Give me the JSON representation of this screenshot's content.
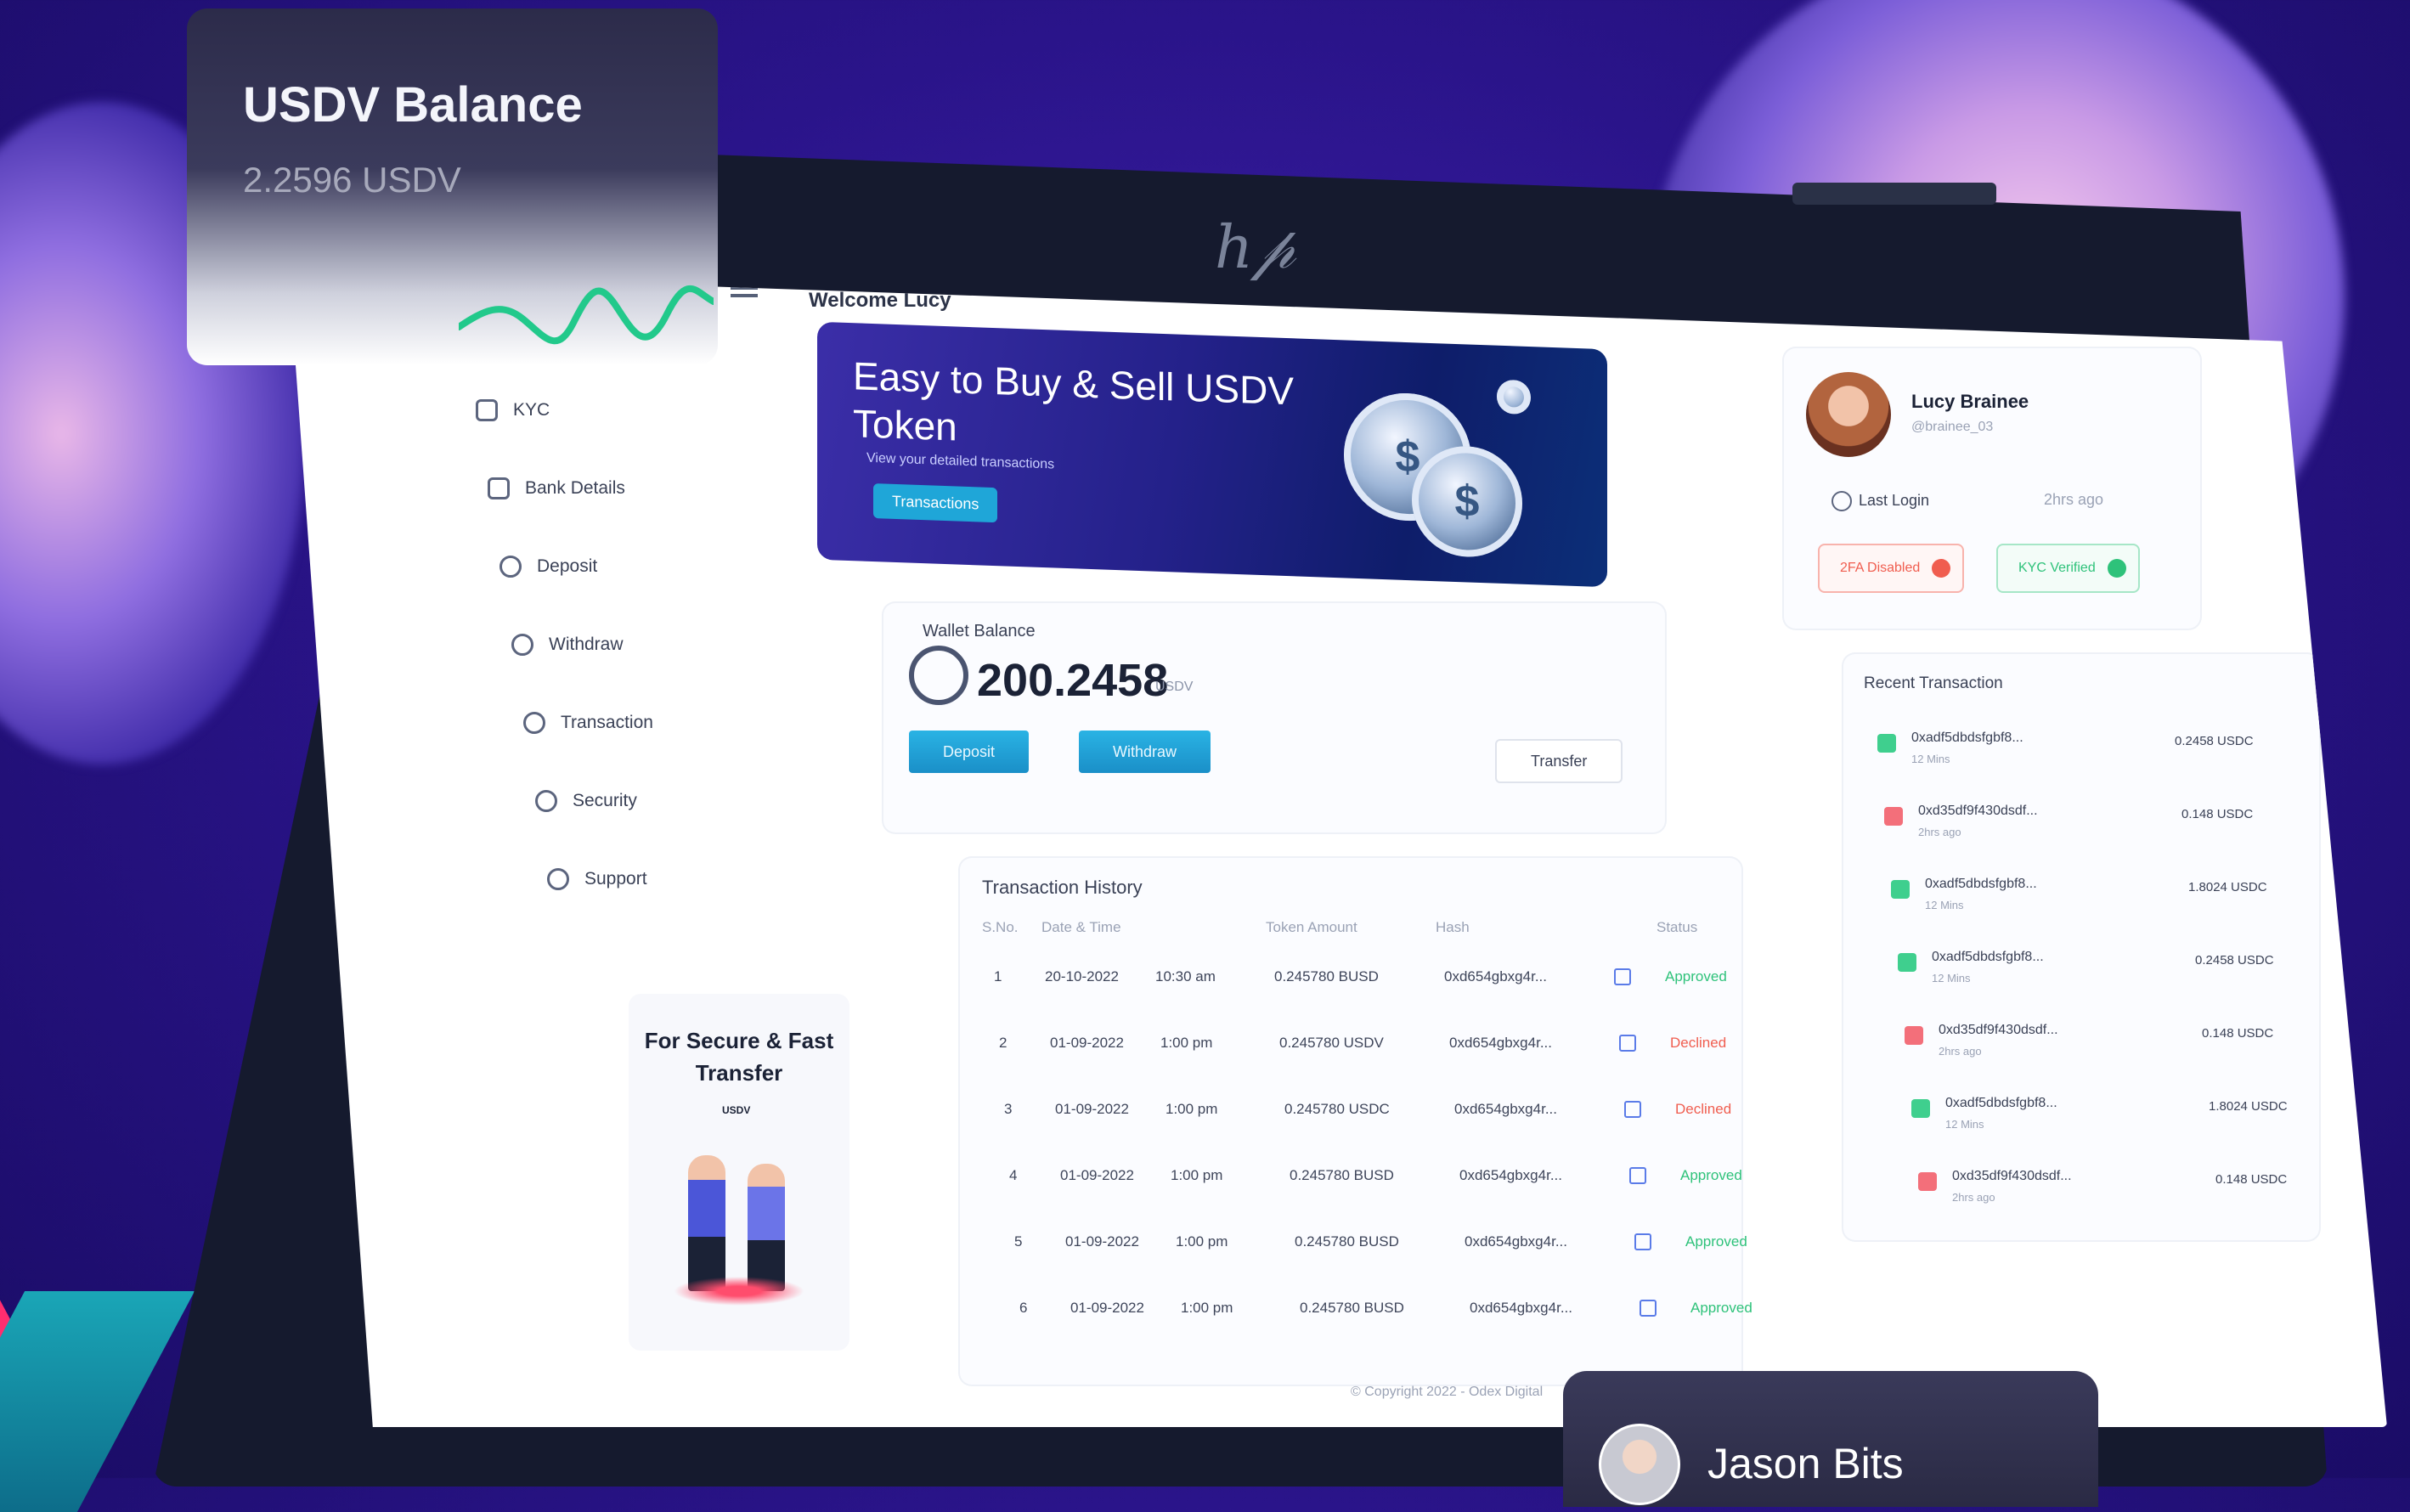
{
  "overlay": {
    "balance_title": "USDV Balance",
    "balance_value": "2.2596 USDV",
    "user_name": "Jason Bits"
  },
  "header": {
    "welcome": "Welcome Lucy"
  },
  "sidebar": {
    "items": [
      {
        "label": "KYC",
        "icon": "document-icon"
      },
      {
        "label": "Bank Details",
        "icon": "bank-icon"
      },
      {
        "label": "Deposit",
        "icon": "deposit-icon"
      },
      {
        "label": "Withdraw",
        "icon": "withdraw-icon"
      },
      {
        "label": "Transaction",
        "icon": "transaction-icon"
      },
      {
        "label": "Security",
        "icon": "shield-icon"
      },
      {
        "label": "Support",
        "icon": "headset-icon"
      }
    ],
    "promo": "For Secure & Fast Transfer",
    "promo_badge": "USDV"
  },
  "banner": {
    "title": "Easy to Buy & Sell USDV Token",
    "subtitle": "View your detailed transactions",
    "button": "Transactions"
  },
  "wallet": {
    "label": "Wallet Balance",
    "amount": "200.2458",
    "unit": "USDV",
    "deposit": "Deposit",
    "withdraw": "Withdraw",
    "transfer": "Transfer"
  },
  "history": {
    "title": "Transaction History",
    "columns": [
      "S.No.",
      "Date & Time",
      "Token Amount",
      "Hash",
      "Status"
    ],
    "rows": [
      {
        "no": "1",
        "date": "20-10-2022",
        "time": "10:30 am",
        "amount": "0.245780 BUSD",
        "hash": "0xd654gbxg4r...",
        "status": "Approved"
      },
      {
        "no": "2",
        "date": "01-09-2022",
        "time": "1:00 pm",
        "amount": "0.245780 USDV",
        "hash": "0xd654gbxg4r...",
        "status": "Declined"
      },
      {
        "no": "3",
        "date": "01-09-2022",
        "time": "1:00 pm",
        "amount": "0.245780 USDC",
        "hash": "0xd654gbxg4r...",
        "status": "Declined"
      },
      {
        "no": "4",
        "date": "01-09-2022",
        "time": "1:00 pm",
        "amount": "0.245780 BUSD",
        "hash": "0xd654gbxg4r...",
        "status": "Approved"
      },
      {
        "no": "5",
        "date": "01-09-2022",
        "time": "1:00 pm",
        "amount": "0.245780 BUSD",
        "hash": "0xd654gbxg4r...",
        "status": "Approved"
      },
      {
        "no": "6",
        "date": "01-09-2022",
        "time": "1:00 pm",
        "amount": "0.245780 BUSD",
        "hash": "0xd654gbxg4r...",
        "status": "Approved"
      }
    ]
  },
  "profile": {
    "name": "Lucy Brainee",
    "handle": "@brainee_03",
    "last_login_label": "Last Login",
    "last_login_value": "2hrs ago",
    "badge_2fa": "2FA Disabled",
    "badge_kyc": "KYC Verified"
  },
  "recent": {
    "title": "Recent Transaction",
    "items": [
      {
        "hash": "0xadf5dbdsfgbf8...",
        "time": "12 Mins",
        "amount": "0.2458 USDC",
        "dir": "in"
      },
      {
        "hash": "0xd35df9f430dsdf...",
        "time": "2hrs ago",
        "amount": "0.148 USDC",
        "dir": "out"
      },
      {
        "hash": "0xadf5dbdsfgbf8...",
        "time": "12 Mins",
        "amount": "1.8024 USDC",
        "dir": "in"
      },
      {
        "hash": "0xadf5dbdsfgbf8...",
        "time": "12 Mins",
        "amount": "0.2458 USDC",
        "dir": "in"
      },
      {
        "hash": "0xd35df9f430dsdf...",
        "time": "2hrs ago",
        "amount": "0.148 USDC",
        "dir": "out"
      },
      {
        "hash": "0xadf5dbdsfgbf8...",
        "time": "12 Mins",
        "amount": "1.8024 USDC",
        "dir": "in"
      },
      {
        "hash": "0xd35df9f430dsdf...",
        "time": "2hrs ago",
        "amount": "0.148 USDC",
        "dir": "out"
      }
    ]
  },
  "footer": {
    "copyright": "© Copyright 2022 - Odex Digital"
  },
  "colors": {
    "accent": "#1fa6d8",
    "approved": "#2ec27a",
    "declined": "#f05d4f",
    "sparkline": "#22c98b"
  }
}
